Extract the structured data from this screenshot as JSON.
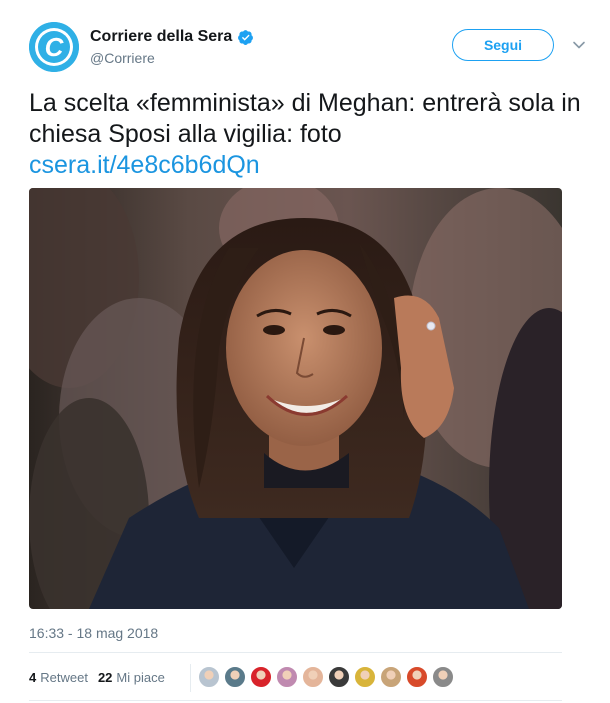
{
  "account": {
    "display_name": "Corriere della Sera",
    "handle": "@Corriere",
    "verified": true,
    "avatar_letter": "C"
  },
  "follow_button": {
    "label": "Segui"
  },
  "tweet": {
    "text": "La scelta «femminista» di Meghan: entrerà sola in chiesa Sposi alla vigilia: foto",
    "link": "csera.it/4e8c6b6dQn"
  },
  "timestamp": "16:33 - 18 mag 2018",
  "stats": {
    "retweets_count": "4",
    "retweets_label": "Retweet",
    "likes_count": "22",
    "likes_label": "Mi piace"
  },
  "colors": {
    "brand_blue": "#1da1f2",
    "link_blue": "#1b95e0",
    "muted": "#657786",
    "avatar_bg": "#2fb0e6"
  },
  "liker_avatars": [
    {
      "color": "#b8c4d0",
      "name": "liker-avatar-1"
    },
    {
      "color": "#5a7a8a",
      "name": "liker-avatar-2"
    },
    {
      "color": "#d8232a",
      "name": "liker-avatar-3"
    },
    {
      "color": "#c08ab0",
      "name": "liker-avatar-4"
    },
    {
      "color": "#e4b59a",
      "name": "liker-avatar-5"
    },
    {
      "color": "#3a3a3a",
      "name": "liker-avatar-6"
    },
    {
      "color": "#d8b43a",
      "name": "liker-avatar-7"
    },
    {
      "color": "#c8a478",
      "name": "liker-avatar-8"
    },
    {
      "color": "#d84a2a",
      "name": "liker-avatar-9"
    },
    {
      "color": "#8a8a8a",
      "name": "liker-avatar-10"
    }
  ]
}
